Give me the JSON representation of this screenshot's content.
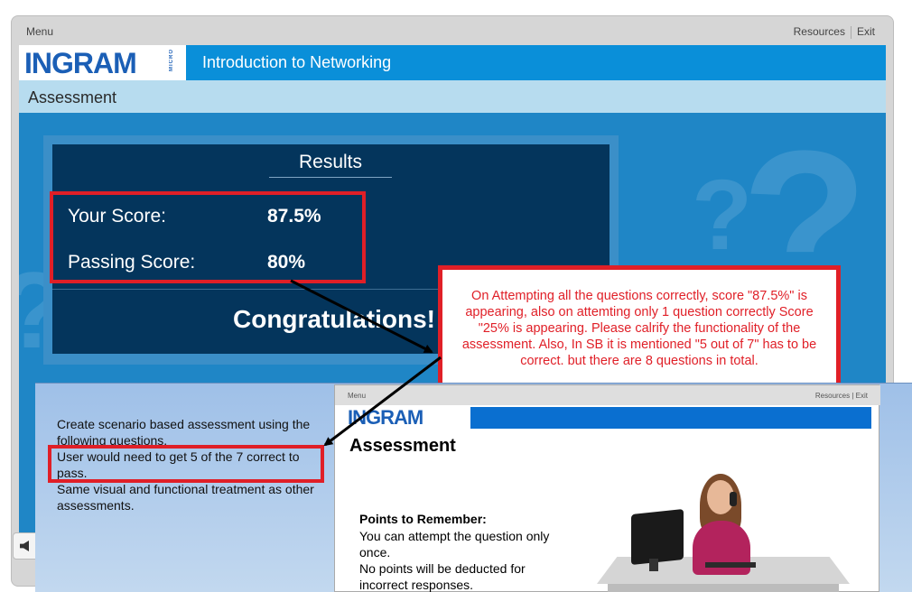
{
  "player": {
    "menu_label": "Menu",
    "resources_label": "Resources",
    "exit_label": "Exit",
    "logo_text": "INGRAM",
    "logo_sub": "MICRO",
    "course_title": "Introduction to Networking",
    "section_title": "Assessment"
  },
  "results": {
    "title": "Results",
    "your_score_label": "Your Score:",
    "your_score_value": "87.5%",
    "passing_score_label": "Passing Score:",
    "passing_score_value": "80%",
    "message": "Congratulations!"
  },
  "comment": {
    "text": "On Attempting all the questions correctly, score \"87.5%\" is appearing, also on attemting only 1 question correctly Score \"25% is appearing.  Please calrify  the functionality of the assessment. Also, In SB it is mentioned \"5 out of 7\" has to be correct. but there are 8 questions in total."
  },
  "storyboard": {
    "line1": "Create scenario based assessment using the following questions.",
    "line2": "User would need to get 5 of the 7 correct to pass.",
    "line3": "Same visual and functional treatment as other assessments.",
    "thumb": {
      "menu_label": "Menu",
      "links_label": "Resources | Exit",
      "logo_text": "INGRAM",
      "title": "Assessment",
      "points_heading": "Points to Remember:",
      "point1": "You can attempt the question only once.",
      "point2": "No points will be deducted for incorrect responses."
    }
  },
  "colors": {
    "header_blue": "#0a8fd9",
    "slide_blue": "#1f86c6",
    "card_navy": "#04355c",
    "annotation_red": "#e01f27"
  },
  "icons": {
    "audio_button": "speaker-icon"
  }
}
